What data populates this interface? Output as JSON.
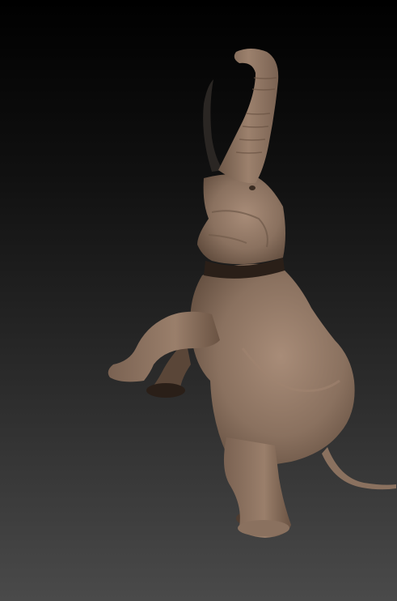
{
  "scene": {
    "subject": "elephant-sculpt",
    "pose": "rearing-on-hind-legs",
    "colors": {
      "background_top": "#000000",
      "background_bottom": "#4a4a4a",
      "clay_base": "#8a715f",
      "clay_highlight": "#a88c78",
      "clay_shadow": "#4e3c30",
      "tusk": "#2a2623",
      "band": "#2a1f18"
    }
  }
}
